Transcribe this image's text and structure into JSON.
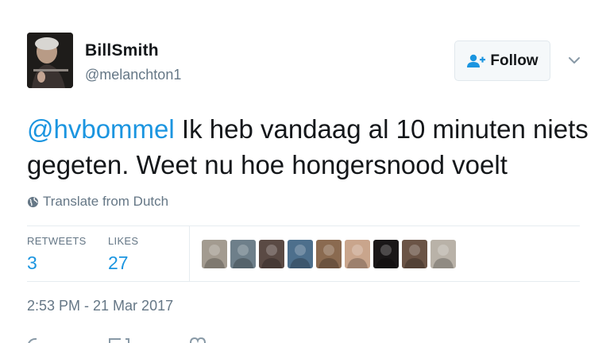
{
  "user": {
    "name": "BillSmith",
    "handle": "@melanchton1",
    "avatar_icon": "profile-photo"
  },
  "follow": {
    "label": "Follow",
    "icon": "add-user-icon"
  },
  "tweet": {
    "mention": "@hvbommel",
    "text": " Ik heb vandaag al 10 minuten niets gegeten. Weet nu hoe hongersnood  voelt"
  },
  "translate": {
    "label": "Translate from Dutch",
    "icon": "globe-icon"
  },
  "stats": {
    "retweets_label": "RETWEETS",
    "retweets_count": "3",
    "likes_label": "LIKES",
    "likes_count": "27"
  },
  "likers": [
    {
      "icon": "liker-avatar",
      "color": "#a39b90"
    },
    {
      "icon": "liker-avatar",
      "color": "#6e7f8a"
    },
    {
      "icon": "liker-avatar",
      "color": "#5a4a44"
    },
    {
      "icon": "liker-avatar",
      "color": "#4d6f8c"
    },
    {
      "icon": "liker-avatar",
      "color": "#8a6a50"
    },
    {
      "icon": "liker-avatar",
      "color": "#c9a58c"
    },
    {
      "icon": "liker-avatar",
      "color": "#1a1718"
    },
    {
      "icon": "liker-avatar",
      "color": "#6b5446"
    },
    {
      "icon": "liker-avatar",
      "color": "#b9b2a8"
    }
  ],
  "timestamp": "2:53 PM - 21 Mar 2017",
  "colors": {
    "accent": "#1b95e0",
    "muted": "#657786",
    "text": "#14171a",
    "border": "#e6ecf0"
  }
}
